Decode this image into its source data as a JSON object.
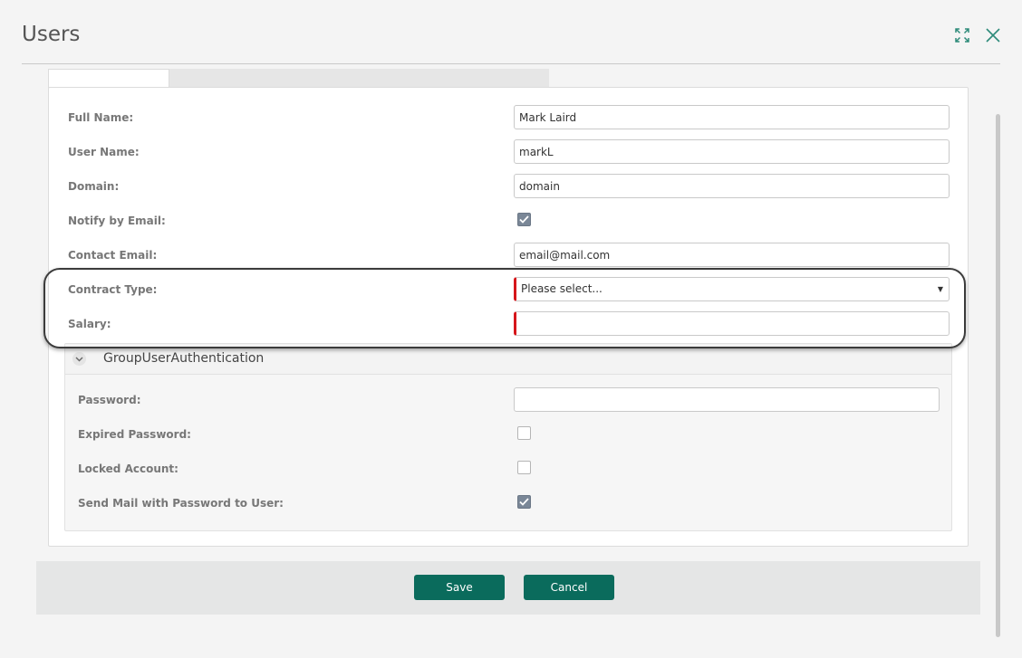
{
  "dialog": {
    "title": "Users",
    "header_icons": [
      "expand-icon",
      "close-icon"
    ]
  },
  "tabs": {
    "active_index": 0
  },
  "form": {
    "full_name": {
      "label": "Full Name:",
      "value": "Mark Laird"
    },
    "user_name": {
      "label": "User Name:",
      "value": "markL"
    },
    "domain": {
      "label": "Domain:",
      "value": "domain"
    },
    "notify_by_email": {
      "label": "Notify by Email:",
      "checked": true
    },
    "contact_email": {
      "label": "Contact Email:",
      "value": "email@mail.com"
    },
    "contract_type": {
      "label": "Contract Type:",
      "placeholder": "Please select...",
      "required": true
    },
    "salary": {
      "label": "Salary:",
      "value": "",
      "required": true
    }
  },
  "group": {
    "title": "GroupUserAuthentication",
    "password": {
      "label": "Password:",
      "value": ""
    },
    "expired_password": {
      "label": "Expired Password:",
      "checked": false
    },
    "locked_account": {
      "label": "Locked Account:",
      "checked": false
    },
    "send_mail": {
      "label": "Send Mail with Password to User:",
      "checked": true
    }
  },
  "footer": {
    "save_label": "Save",
    "cancel_label": "Cancel"
  },
  "colors": {
    "primary_button": "#0a6b5c",
    "required_marker": "#d6161b",
    "checkbox_checked": "#7a8797",
    "icon_accent": "#2e8b7a"
  }
}
